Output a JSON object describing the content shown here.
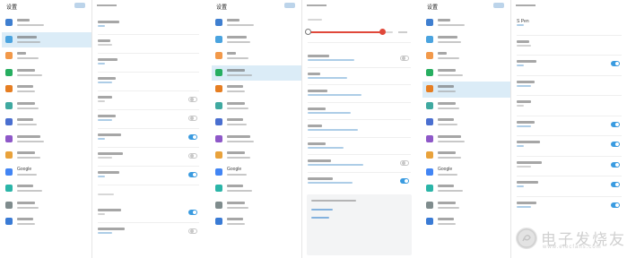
{
  "screens": [
    {
      "top_bar": {
        "title": "设置",
        "search_label": ""
      },
      "settings_list": {
        "selected_index": 1,
        "items": [
          {
            "icon": "connections-icon",
            "color": "#3f7fd0",
            "label": "",
            "sub": ""
          },
          {
            "icon": "sound-icon",
            "color": "#4aa3df",
            "label": "",
            "sub": ""
          },
          {
            "icon": "notifications-icon",
            "color": "#f2994a",
            "label": "",
            "sub": ""
          },
          {
            "icon": "display-icon",
            "color": "#27ae60",
            "label": "",
            "sub": ""
          },
          {
            "icon": "advanced-features-icon",
            "color": "#e67e22",
            "label": "",
            "sub": ""
          },
          {
            "icon": "device-maintenance-icon",
            "color": "#3fa9a0",
            "label": "",
            "sub": ""
          },
          {
            "icon": "apps-icon",
            "color": "#4a6fd0",
            "label": "",
            "sub": ""
          },
          {
            "icon": "lock-screen-icon",
            "color": "#8e58c8",
            "label": "",
            "sub": ""
          },
          {
            "icon": "cloud-accounts-icon",
            "color": "#e9a23b",
            "label": "",
            "sub": ""
          },
          {
            "icon": "google-icon",
            "color": "#4285f4",
            "label": "Google",
            "sub": ""
          },
          {
            "icon": "accessibility-icon",
            "color": "#2bb5a8",
            "label": "",
            "sub": ""
          },
          {
            "icon": "general-management-icon",
            "color": "#7f8c8d",
            "label": "",
            "sub": ""
          },
          {
            "icon": "software-update-icon",
            "color": "#3a7bd5",
            "label": "",
            "sub": ""
          }
        ]
      },
      "detail": {
        "rows": [
          {
            "kind": "row",
            "label": "",
            "sub": "",
            "toggle": null
          },
          {
            "kind": "row",
            "label": "",
            "sub": "",
            "toggle": null
          },
          {
            "kind": "row",
            "label": "",
            "sub": "",
            "toggle": null
          },
          {
            "kind": "row",
            "label": "",
            "sub": "",
            "toggle": null
          },
          {
            "kind": "row",
            "label": "",
            "sub": "",
            "toggle": "off"
          },
          {
            "kind": "row",
            "label": "",
            "sub": "",
            "toggle": "off"
          },
          {
            "kind": "row",
            "label": "",
            "sub": "",
            "toggle": "on"
          },
          {
            "kind": "row",
            "label": "",
            "sub": "",
            "toggle": "off"
          },
          {
            "kind": "row",
            "label": "",
            "sub": "",
            "toggle": "on"
          },
          {
            "kind": "section",
            "label": ""
          },
          {
            "kind": "row",
            "label": "",
            "sub": "",
            "toggle": "on"
          },
          {
            "kind": "row",
            "label": "",
            "sub": "",
            "toggle": "off"
          }
        ]
      }
    },
    {
      "top_bar": {
        "title": "设置",
        "search_label": ""
      },
      "settings_list": {
        "selected_index": 3,
        "items": [
          {
            "icon": "connections-icon",
            "color": "#3f7fd0",
            "label": "",
            "sub": ""
          },
          {
            "icon": "sound-icon",
            "color": "#4aa3df",
            "label": "",
            "sub": ""
          },
          {
            "icon": "notifications-icon",
            "color": "#f2994a",
            "label": "",
            "sub": ""
          },
          {
            "icon": "display-icon",
            "color": "#27ae60",
            "label": "",
            "sub": ""
          },
          {
            "icon": "advanced-features-icon",
            "color": "#e67e22",
            "label": "",
            "sub": ""
          },
          {
            "icon": "device-maintenance-icon",
            "color": "#3fa9a0",
            "label": "",
            "sub": ""
          },
          {
            "icon": "apps-icon",
            "color": "#4a6fd0",
            "label": "",
            "sub": ""
          },
          {
            "icon": "lock-screen-icon",
            "color": "#8e58c8",
            "label": "",
            "sub": ""
          },
          {
            "icon": "cloud-accounts-icon",
            "color": "#e9a23b",
            "label": "",
            "sub": ""
          },
          {
            "icon": "google-icon",
            "color": "#4285f4",
            "label": "Google",
            "sub": ""
          },
          {
            "icon": "accessibility-icon",
            "color": "#2bb5a8",
            "label": "",
            "sub": ""
          },
          {
            "icon": "general-management-icon",
            "color": "#7f8c8d",
            "label": "",
            "sub": ""
          },
          {
            "icon": "software-update-icon",
            "color": "#3a7bd5",
            "label": "",
            "sub": ""
          }
        ]
      },
      "detail": {
        "brightness": {
          "section_label": "",
          "level": 0.87,
          "auto_label": "",
          "accent": "#e0483a"
        },
        "rows": [
          {
            "kind": "row",
            "label": "",
            "sub": "",
            "toggle": "off"
          },
          {
            "kind": "row",
            "label": "",
            "sub": "",
            "toggle": null
          },
          {
            "kind": "row",
            "label": "",
            "sub": "",
            "toggle": null
          },
          {
            "kind": "row",
            "label": "",
            "sub": "",
            "toggle": null
          },
          {
            "kind": "row",
            "label": "",
            "sub": "",
            "toggle": null
          },
          {
            "kind": "row",
            "label": "",
            "sub": "",
            "toggle": null
          },
          {
            "kind": "row",
            "label": "",
            "sub": "",
            "toggle": "off"
          },
          {
            "kind": "row",
            "label": "",
            "sub": "",
            "toggle": "on"
          }
        ],
        "popup": {
          "title": "",
          "links": [
            "",
            ""
          ]
        }
      }
    },
    {
      "top_bar": {
        "title": "设置",
        "search_label": ""
      },
      "settings_list": {
        "selected_index": 4,
        "items": [
          {
            "icon": "connections-icon",
            "color": "#3f7fd0",
            "label": "",
            "sub": ""
          },
          {
            "icon": "sound-icon",
            "color": "#4aa3df",
            "label": "",
            "sub": ""
          },
          {
            "icon": "notifications-icon",
            "color": "#f2994a",
            "label": "",
            "sub": ""
          },
          {
            "icon": "display-icon",
            "color": "#27ae60",
            "label": "",
            "sub": ""
          },
          {
            "icon": "advanced-features-icon",
            "color": "#e67e22",
            "label": "",
            "sub": ""
          },
          {
            "icon": "device-maintenance-icon",
            "color": "#3fa9a0",
            "label": "",
            "sub": ""
          },
          {
            "icon": "apps-icon",
            "color": "#4a6fd0",
            "label": "",
            "sub": ""
          },
          {
            "icon": "lock-screen-icon",
            "color": "#8e58c8",
            "label": "",
            "sub": ""
          },
          {
            "icon": "cloud-accounts-icon",
            "color": "#e9a23b",
            "label": "",
            "sub": ""
          },
          {
            "icon": "google-icon",
            "color": "#4285f4",
            "label": "Google",
            "sub": ""
          },
          {
            "icon": "accessibility-icon",
            "color": "#2bb5a8",
            "label": "",
            "sub": ""
          },
          {
            "icon": "general-management-icon",
            "color": "#7f8c8d",
            "label": "",
            "sub": ""
          },
          {
            "icon": "software-update-icon",
            "color": "#3a7bd5",
            "label": "",
            "sub": ""
          }
        ]
      },
      "detail": {
        "rows": [
          {
            "kind": "row",
            "label": "S Pen",
            "sub": "",
            "toggle": null
          },
          {
            "kind": "row",
            "label": "",
            "sub": "",
            "toggle": null
          },
          {
            "kind": "row",
            "label": "",
            "sub": "",
            "toggle": "on"
          },
          {
            "kind": "row",
            "label": "",
            "sub": "",
            "toggle": null
          },
          {
            "kind": "row",
            "label": "",
            "sub": "",
            "toggle": null
          },
          {
            "kind": "row",
            "label": "",
            "sub": "",
            "toggle": "on"
          },
          {
            "kind": "row",
            "label": "",
            "sub": "",
            "toggle": "on"
          },
          {
            "kind": "row",
            "label": "",
            "sub": "",
            "toggle": "on"
          },
          {
            "kind": "row",
            "label": "",
            "sub": "",
            "toggle": "on"
          },
          {
            "kind": "row",
            "label": "",
            "sub": "",
            "toggle": "on"
          }
        ]
      }
    }
  ],
  "theme": {
    "selected_bg": "#dbecf7",
    "toggle_on": "#3a9be0",
    "divider": "#e6e6e6"
  },
  "watermark": {
    "logo": "elecfans-logo-icon",
    "text": "电子发烧友",
    "url": "www.elecfans.com"
  }
}
